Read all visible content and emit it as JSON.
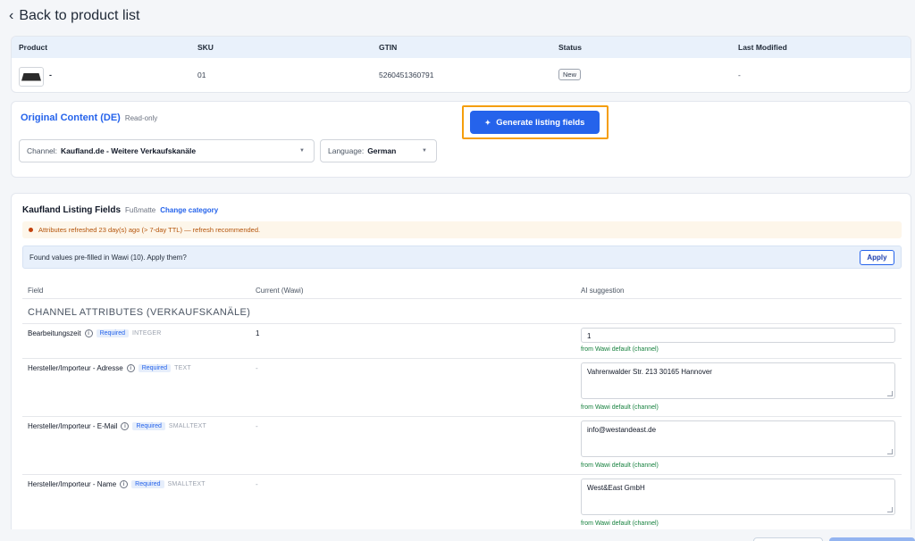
{
  "back": {
    "label": "Back to product list"
  },
  "product_table": {
    "headers": [
      "Product",
      "SKU",
      "GTIN",
      "Status",
      "Last Modified"
    ],
    "row": {
      "name": "-",
      "sku": "01",
      "gtin": "5260451360791",
      "status": "New",
      "last_modified": "-"
    }
  },
  "original_content": {
    "title": "Original Content (DE)",
    "readonly": "Read-only",
    "generate_button": "Generate listing fields",
    "channel_label": "Channel:",
    "channel_value": "Kaufland.de - Weitere Verkaufskanäle",
    "language_label": "Language:",
    "language_value": "German"
  },
  "listing": {
    "title": "Kaufland Listing Fields",
    "category": "Fußmatte",
    "change_category": "Change category",
    "warning": "Attributes refreshed 23 day(s) ago (> 7-day TTL) — refresh recommended.",
    "info": "Found values pre-filled in Wawi (10). Apply them?",
    "apply": "Apply",
    "columns": {
      "field": "Field",
      "current": "Current (Wawi)",
      "ai": "AI suggestion"
    },
    "section": "CHANNEL ATTRIBUTES (VERKAUFSKANÄLE)",
    "rows": [
      {
        "label": "Bearbeitungszeit",
        "required": "Required",
        "type": "INTEGER",
        "current": "1",
        "ai": "1",
        "hint": "from Wawi default (channel)"
      },
      {
        "label": "Hersteller/Importeur - Adresse",
        "required": "Required",
        "type": "TEXT",
        "current": "-",
        "ai": "Vahrenwalder Str. 213 30165 Hannover",
        "hint": "from Wawi default (channel)"
      },
      {
        "label": "Hersteller/Importeur - E-Mail",
        "required": "Required",
        "type": "SMALLTEXT",
        "current": "-",
        "ai": "info@westandeast.de",
        "hint": "from Wawi default (channel)"
      },
      {
        "label": "Hersteller/Importeur - Name",
        "required": "Required",
        "type": "SMALLTEXT",
        "current": "-",
        "ai": "West&East GmbH",
        "hint": "from Wawi default (channel)"
      }
    ]
  },
  "colors": {
    "accent": "#2563eb",
    "highlight": "#f59e0b",
    "warning": "#b45309",
    "hint": "#15803d"
  },
  "icons": [
    "chevron-left-icon",
    "sparkle-icon",
    "chevron-down-icon",
    "info-icon",
    "warning-dot-icon"
  ]
}
